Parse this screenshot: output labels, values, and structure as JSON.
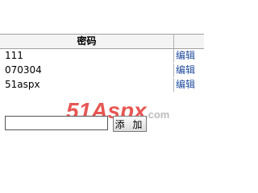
{
  "grid": {
    "headers": {
      "password": "密码",
      "action": ""
    },
    "rows": [
      {
        "password": "111",
        "action": "编辑"
      },
      {
        "password": "070304",
        "action": "编辑"
      },
      {
        "password": "51aspx",
        "action": "编辑"
      }
    ]
  },
  "add_form": {
    "input_value": "",
    "button_label": "添 加"
  },
  "watermark": {
    "brand": "51Aspx",
    "suffix": ".com"
  },
  "colors": {
    "link": "#1f4b9c",
    "watermark_red": "#e23a36",
    "watermark_gray": "#bcbcbc"
  }
}
